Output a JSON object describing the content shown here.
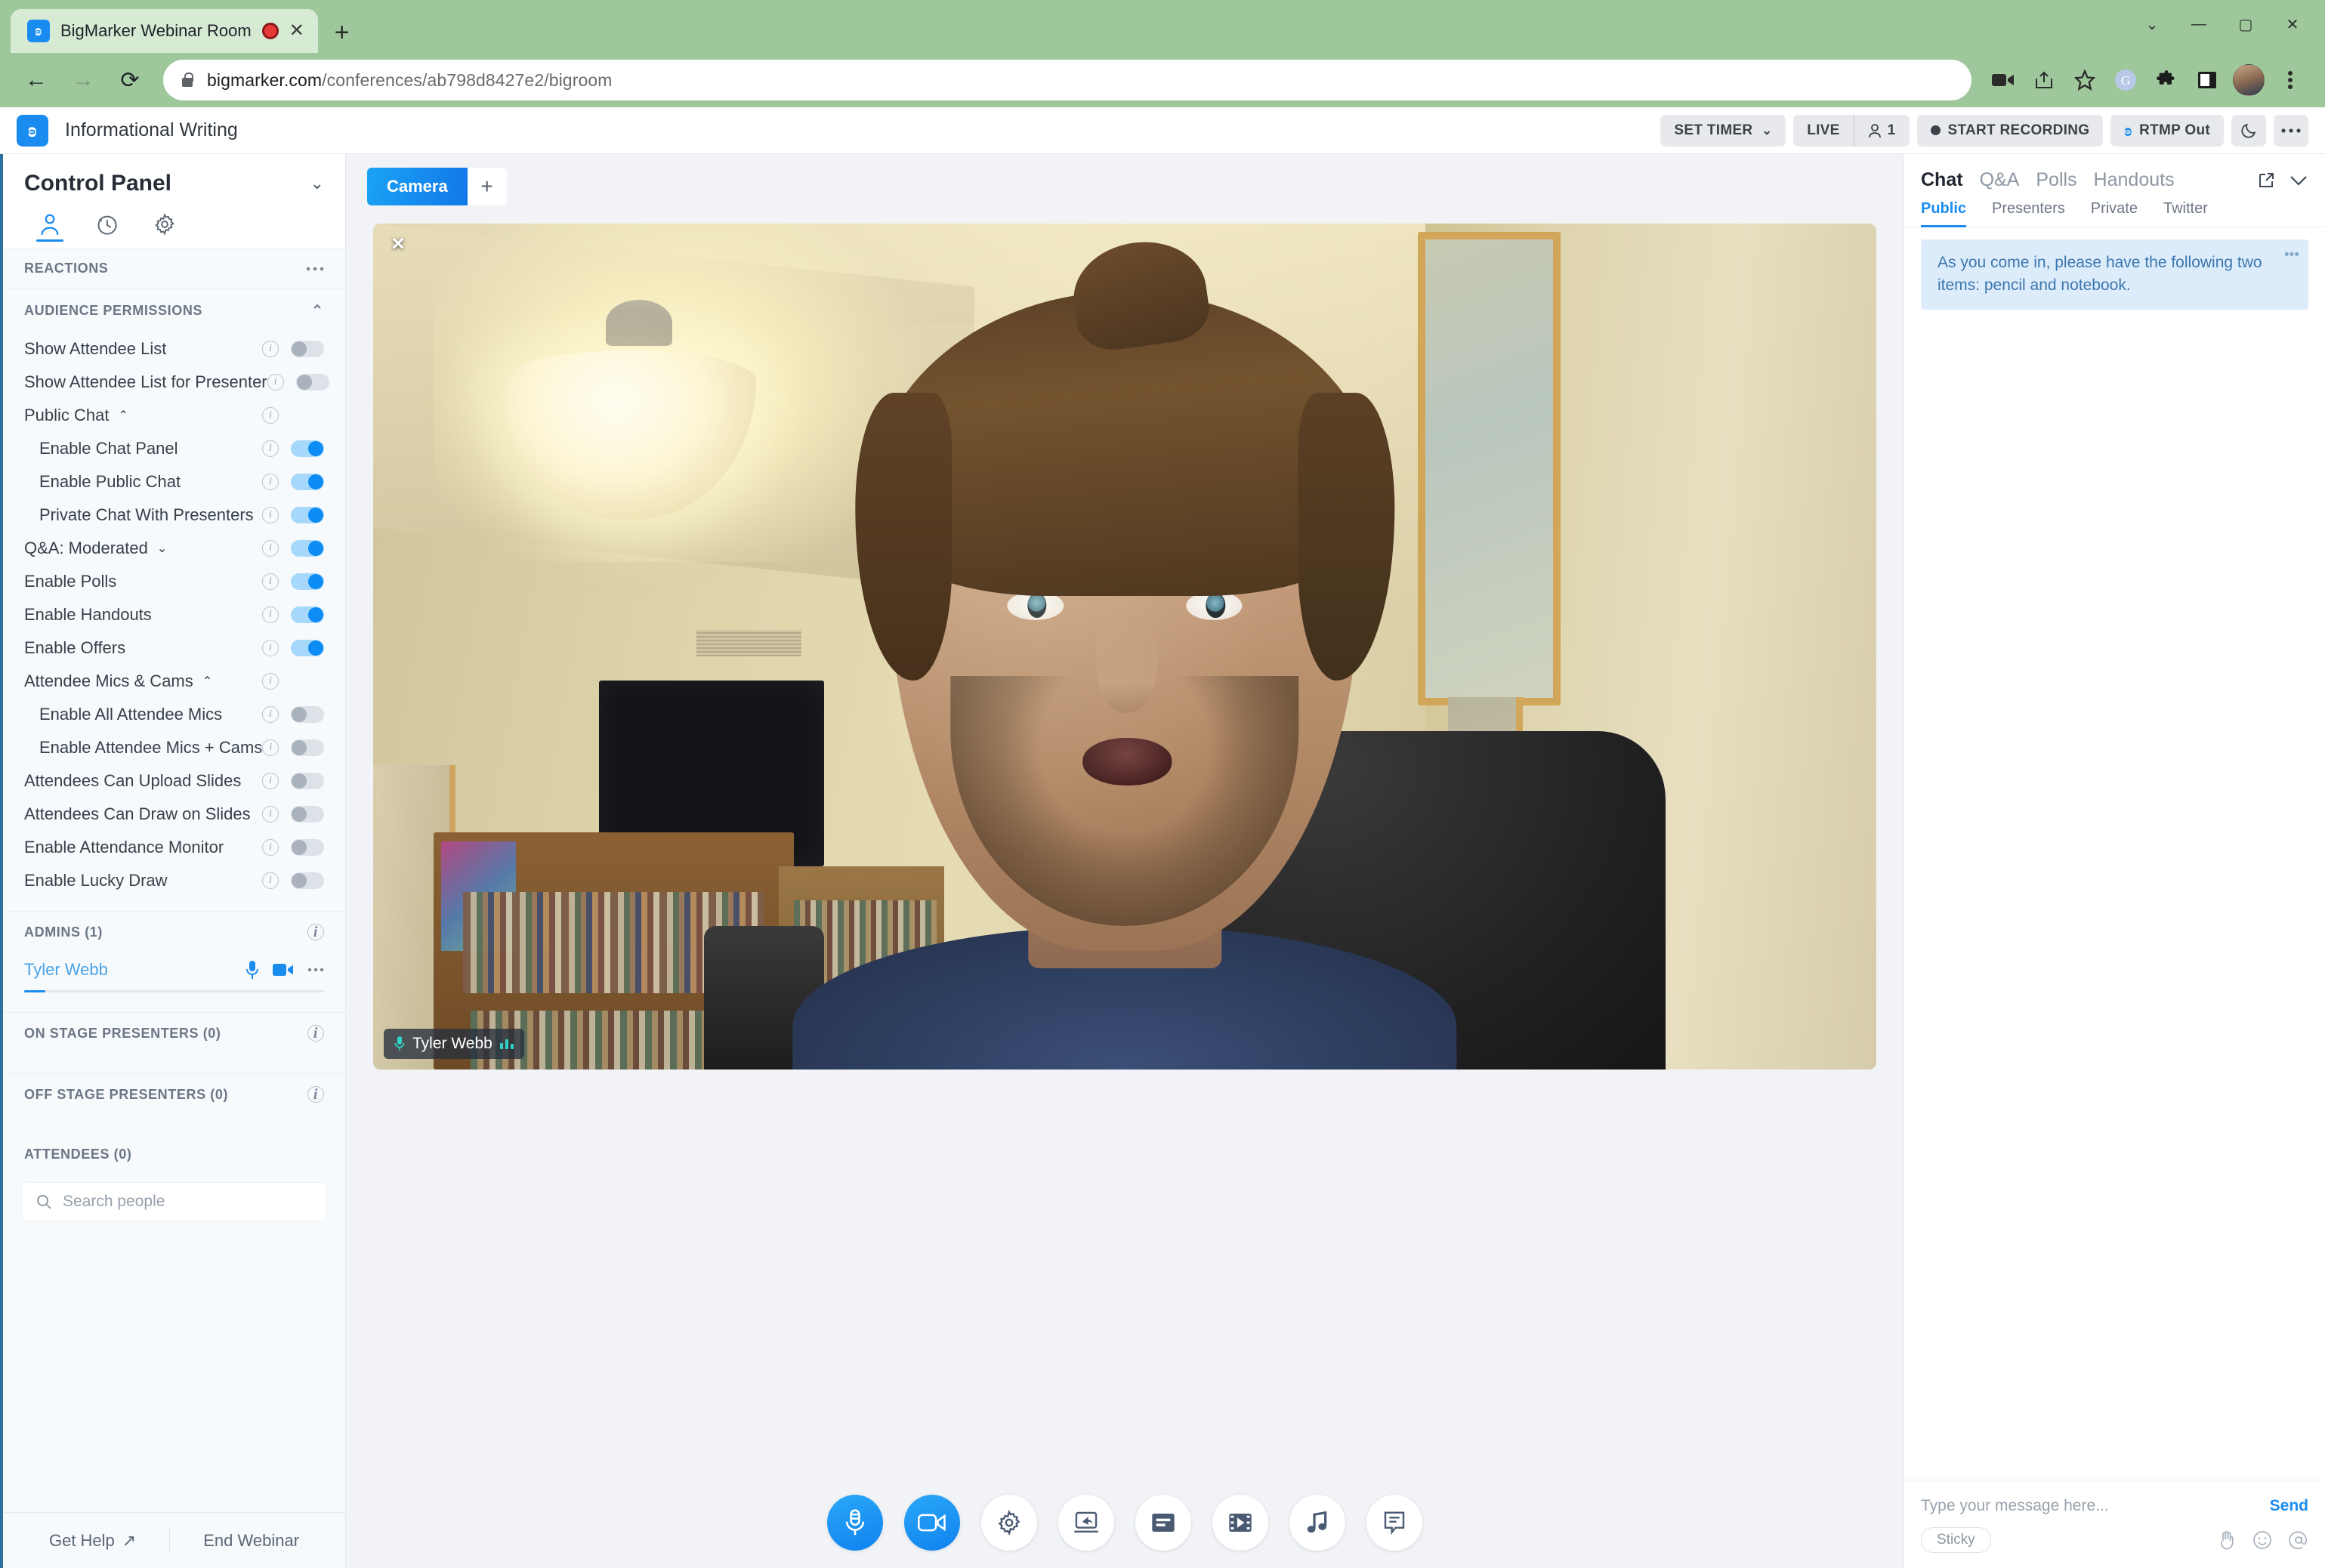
{
  "browser": {
    "tab_title": "BigMarker Webinar Room",
    "tab_favicon": "bigmarker-logo-icon",
    "recording_indicator": "recording-dot-icon",
    "new_tab_label": "+",
    "back": "←",
    "forward": "→",
    "reload": "⟳",
    "url_host": "bigmarker.com",
    "url_path": "/conferences/ab798d8427e2/bigroom",
    "window_controls": [
      "minimize",
      "maximize",
      "close"
    ]
  },
  "app": {
    "logo": "bigmarker-logo-icon",
    "title": "Informational Writing",
    "header_actions": {
      "set_timer": "SET TIMER",
      "live": "LIVE",
      "attendee_count": "1",
      "start_recording": "START RECORDING",
      "rtmp_out": "RTMP Out",
      "moon_icon": "moon-icon",
      "more_icon": "more-horizontal-icon"
    }
  },
  "sidebar": {
    "panel_title": "Control Panel",
    "tabs": [
      {
        "name": "people",
        "icon": "person-icon",
        "active": true
      },
      {
        "name": "history",
        "icon": "clock-icon",
        "active": false
      },
      {
        "name": "settings",
        "icon": "gear-icon",
        "active": false
      }
    ],
    "reactions_header": "REACTIONS",
    "permissions_header": "AUDIENCE PERMISSIONS",
    "permissions": [
      {
        "label": "Show Attendee List",
        "on": false,
        "indent": false,
        "chevron": null,
        "has_toggle": true
      },
      {
        "label": "Show Attendee List for Presenter",
        "on": false,
        "indent": false,
        "chevron": null,
        "has_toggle": true
      },
      {
        "label": "Public Chat",
        "on": null,
        "indent": false,
        "chevron": "up",
        "has_toggle": false
      },
      {
        "label": "Enable Chat Panel",
        "on": true,
        "indent": true,
        "chevron": null,
        "has_toggle": true
      },
      {
        "label": "Enable Public Chat",
        "on": true,
        "indent": true,
        "chevron": null,
        "has_toggle": true
      },
      {
        "label": "Private Chat With Presenters",
        "on": true,
        "indent": true,
        "chevron": null,
        "has_toggle": true
      },
      {
        "label": "Q&A: Moderated",
        "on": true,
        "indent": false,
        "chevron": "down",
        "has_toggle": true
      },
      {
        "label": "Enable Polls",
        "on": true,
        "indent": false,
        "chevron": null,
        "has_toggle": true
      },
      {
        "label": "Enable Handouts",
        "on": true,
        "indent": false,
        "chevron": null,
        "has_toggle": true
      },
      {
        "label": "Enable Offers",
        "on": true,
        "indent": false,
        "chevron": null,
        "has_toggle": true
      },
      {
        "label": "Attendee Mics & Cams",
        "on": null,
        "indent": false,
        "chevron": "up",
        "has_toggle": false
      },
      {
        "label": "Enable All Attendee Mics",
        "on": false,
        "indent": true,
        "chevron": null,
        "has_toggle": true
      },
      {
        "label": "Enable Attendee Mics + Cams",
        "on": false,
        "indent": true,
        "chevron": null,
        "has_toggle": true
      },
      {
        "label": "Attendees Can Upload Slides",
        "on": false,
        "indent": false,
        "chevron": null,
        "has_toggle": true
      },
      {
        "label": "Attendees Can Draw on Slides",
        "on": false,
        "indent": false,
        "chevron": null,
        "has_toggle": true
      },
      {
        "label": "Enable Attendance Monitor",
        "on": false,
        "indent": false,
        "chevron": null,
        "has_toggle": true
      },
      {
        "label": "Enable Lucky Draw",
        "on": false,
        "indent": false,
        "chevron": null,
        "has_toggle": true
      }
    ],
    "admins_header": "ADMINS (1)",
    "admins": [
      {
        "name": "Tyler Webb",
        "mic": "mic-icon",
        "cam": "video-camera-icon",
        "more": "more-horizontal-icon"
      }
    ],
    "on_stage_header": "ON STAGE PRESENTERS (0)",
    "off_stage_header": "OFF STAGE PRESENTERS (0)",
    "attendees_header": "ATTENDEES (0)",
    "search_placeholder": "Search people",
    "footer": {
      "get_help": "Get Help",
      "end_webinar": "End Webinar"
    }
  },
  "stage": {
    "camera_tab": "Camera",
    "add_tab": "+",
    "close_video": "×",
    "video_nametag": "Tyler Webb",
    "controls": [
      {
        "name": "microphone-toggle",
        "icon": "mic-icon",
        "active": true
      },
      {
        "name": "camera-toggle",
        "icon": "video-camera-icon",
        "active": true
      },
      {
        "name": "settings-button",
        "icon": "gear-icon",
        "active": false
      },
      {
        "name": "share-screen-button",
        "icon": "screen-share-icon",
        "active": false
      },
      {
        "name": "slides-button",
        "icon": "slides-icon",
        "active": false
      },
      {
        "name": "video-clip-button",
        "icon": "film-icon",
        "active": false
      },
      {
        "name": "music-button",
        "icon": "music-note-icon",
        "active": false
      },
      {
        "name": "notes-button",
        "icon": "notes-icon",
        "active": false
      }
    ]
  },
  "chat": {
    "tabs": [
      {
        "label": "Chat",
        "active": true
      },
      {
        "label": "Q&A",
        "active": false
      },
      {
        "label": "Polls",
        "active": false
      },
      {
        "label": "Handouts",
        "active": false
      }
    ],
    "tools": {
      "popout_icon": "external-link-icon",
      "collapse_icon": "chevron-down-icon"
    },
    "sub_tabs": [
      {
        "label": "Public",
        "active": true
      },
      {
        "label": "Presenters",
        "active": false
      },
      {
        "label": "Private",
        "active": false
      },
      {
        "label": "Twitter",
        "active": false
      }
    ],
    "messages": [
      {
        "text": "As you come in, please have the following two items: pencil and notebook.",
        "more": "more-horizontal-icon"
      }
    ],
    "input_placeholder": "Type your message here...",
    "send_label": "Send",
    "sticky_label": "Sticky",
    "footer_icons": [
      "hand-icon",
      "emoji-icon",
      "mention-icon"
    ]
  },
  "colors": {
    "accent": "#1a8cf0",
    "toggle_on": "#0d8cf5",
    "toggle_off": "#a9b2bd",
    "chrome_green": "#9ec89b",
    "sidebar_bg": "#f7fafc",
    "stage_bg": "#f1f3f6"
  }
}
